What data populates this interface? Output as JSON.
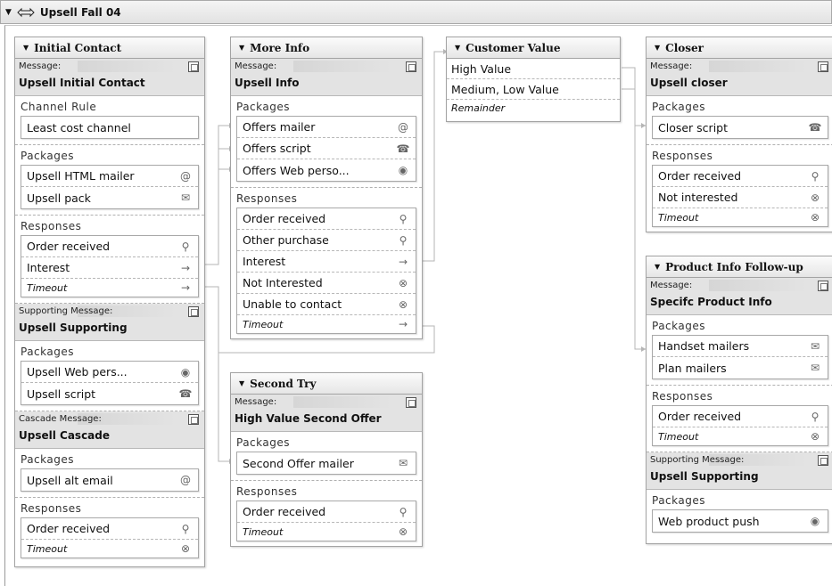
{
  "workflow": {
    "title": "Upsell Fall 04"
  },
  "labels": {
    "message": "Message:",
    "supporting_message": "Supporting Message:",
    "cascade_message": "Cascade Message:",
    "channel_rule": "Channel Rule",
    "packages": "Packages",
    "responses": "Responses"
  },
  "initial_contact": {
    "title": "Initial Contact",
    "message": "Upsell Initial Contact",
    "channel_rule": "Least cost channel",
    "packages": [
      {
        "label": "Upsell HTML mailer",
        "icon": "at-icon"
      },
      {
        "label": "Upsell pack",
        "icon": "envelope-icon"
      }
    ],
    "responses": [
      {
        "label": "Order received",
        "icon": "order-icon"
      },
      {
        "label": "Interest",
        "icon": "arrow-icon"
      },
      {
        "label": "Timeout",
        "icon": "arrow-icon"
      }
    ],
    "supporting_message": "Upsell Supporting",
    "supporting_packages": [
      {
        "label": "Upsell Web pers...",
        "icon": "globe-icon"
      },
      {
        "label": "Upsell script",
        "icon": "phone-icon"
      }
    ],
    "cascade_message": "Upsell Cascade",
    "cascade_packages": [
      {
        "label": "Upsell alt email",
        "icon": "at-icon"
      }
    ],
    "cascade_responses": [
      {
        "label": "Order received",
        "icon": "order-icon"
      },
      {
        "label": "Timeout",
        "icon": "stop-icon"
      }
    ]
  },
  "more_info": {
    "title": "More Info",
    "message": "Upsell Info",
    "packages": [
      {
        "label": "Offers mailer",
        "icon": "at-icon"
      },
      {
        "label": "Offers script",
        "icon": "phone-icon"
      },
      {
        "label": "Offers Web perso...",
        "icon": "globe-icon"
      }
    ],
    "responses": [
      {
        "label": "Order received",
        "icon": "order-icon"
      },
      {
        "label": "Other purchase",
        "icon": "order-icon"
      },
      {
        "label": "Interest",
        "icon": "arrow-icon"
      },
      {
        "label": "Not Interested",
        "icon": "stop-icon"
      },
      {
        "label": "Unable to contact",
        "icon": "stop-icon"
      },
      {
        "label": "Timeout",
        "icon": "arrow-icon"
      }
    ]
  },
  "customer_value": {
    "title": "Customer Value",
    "rows": [
      "High Value",
      "Medium, Low Value",
      "Remainder"
    ]
  },
  "closer": {
    "title": "Closer",
    "message": "Upsell closer",
    "packages": [
      {
        "label": "Closer script",
        "icon": "phone-icon"
      }
    ],
    "responses": [
      {
        "label": "Order received",
        "icon": "order-icon"
      },
      {
        "label": "Not interested",
        "icon": "stop-icon"
      },
      {
        "label": "Timeout",
        "icon": "stop-icon"
      }
    ]
  },
  "second_try": {
    "title": "Second Try",
    "message": "High Value Second Offer",
    "packages": [
      {
        "label": "Second Offer mailer",
        "icon": "envelope-icon"
      }
    ],
    "responses": [
      {
        "label": "Order received",
        "icon": "order-icon"
      },
      {
        "label": "Timeout",
        "icon": "stop-icon"
      }
    ]
  },
  "product_info": {
    "title": "Product Info Follow-up",
    "message": "Specifc Product Info",
    "packages": [
      {
        "label": "Handset mailers",
        "icon": "envelope-icon"
      },
      {
        "label": "Plan mailers",
        "icon": "envelope-icon"
      }
    ],
    "responses": [
      {
        "label": "Order received",
        "icon": "order-icon"
      },
      {
        "label": "Timeout",
        "icon": "stop-icon"
      }
    ],
    "supporting_message": "Upsell Supporting",
    "supporting_packages": [
      {
        "label": "Web product push",
        "icon": "globe-icon"
      }
    ]
  }
}
